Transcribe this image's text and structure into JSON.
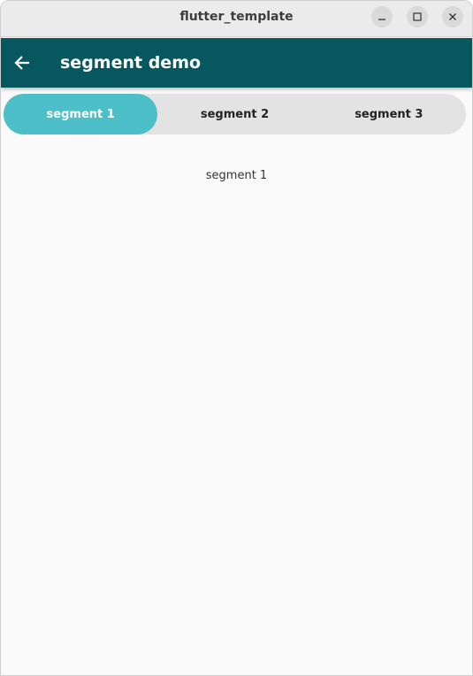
{
  "window": {
    "title": "flutter_template"
  },
  "appbar": {
    "title": "segment demo",
    "back_icon": "arrow-left-icon",
    "color": "#07575e"
  },
  "segments": {
    "items": [
      {
        "label": "segment 1",
        "selected": true
      },
      {
        "label": "segment 2",
        "selected": false
      },
      {
        "label": "segment 3",
        "selected": false
      }
    ],
    "selected_color": "#4cbfc9",
    "track_color": "#e3e3e3"
  },
  "content": {
    "text": "segment 1"
  }
}
